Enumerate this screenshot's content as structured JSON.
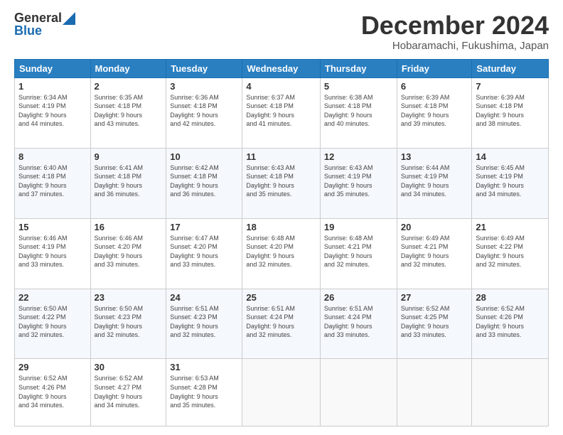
{
  "header": {
    "logo_general": "General",
    "logo_blue": "Blue",
    "month_title": "December 2024",
    "location": "Hobaramachi, Fukushima, Japan"
  },
  "days_of_week": [
    "Sunday",
    "Monday",
    "Tuesday",
    "Wednesday",
    "Thursday",
    "Friday",
    "Saturday"
  ],
  "weeks": [
    [
      {
        "day": "1",
        "info": "Sunrise: 6:34 AM\nSunset: 4:19 PM\nDaylight: 9 hours\nand 44 minutes."
      },
      {
        "day": "2",
        "info": "Sunrise: 6:35 AM\nSunset: 4:18 PM\nDaylight: 9 hours\nand 43 minutes."
      },
      {
        "day": "3",
        "info": "Sunrise: 6:36 AM\nSunset: 4:18 PM\nDaylight: 9 hours\nand 42 minutes."
      },
      {
        "day": "4",
        "info": "Sunrise: 6:37 AM\nSunset: 4:18 PM\nDaylight: 9 hours\nand 41 minutes."
      },
      {
        "day": "5",
        "info": "Sunrise: 6:38 AM\nSunset: 4:18 PM\nDaylight: 9 hours\nand 40 minutes."
      },
      {
        "day": "6",
        "info": "Sunrise: 6:39 AM\nSunset: 4:18 PM\nDaylight: 9 hours\nand 39 minutes."
      },
      {
        "day": "7",
        "info": "Sunrise: 6:39 AM\nSunset: 4:18 PM\nDaylight: 9 hours\nand 38 minutes."
      }
    ],
    [
      {
        "day": "8",
        "info": "Sunrise: 6:40 AM\nSunset: 4:18 PM\nDaylight: 9 hours\nand 37 minutes."
      },
      {
        "day": "9",
        "info": "Sunrise: 6:41 AM\nSunset: 4:18 PM\nDaylight: 9 hours\nand 36 minutes."
      },
      {
        "day": "10",
        "info": "Sunrise: 6:42 AM\nSunset: 4:18 PM\nDaylight: 9 hours\nand 36 minutes."
      },
      {
        "day": "11",
        "info": "Sunrise: 6:43 AM\nSunset: 4:18 PM\nDaylight: 9 hours\nand 35 minutes."
      },
      {
        "day": "12",
        "info": "Sunrise: 6:43 AM\nSunset: 4:19 PM\nDaylight: 9 hours\nand 35 minutes."
      },
      {
        "day": "13",
        "info": "Sunrise: 6:44 AM\nSunset: 4:19 PM\nDaylight: 9 hours\nand 34 minutes."
      },
      {
        "day": "14",
        "info": "Sunrise: 6:45 AM\nSunset: 4:19 PM\nDaylight: 9 hours\nand 34 minutes."
      }
    ],
    [
      {
        "day": "15",
        "info": "Sunrise: 6:46 AM\nSunset: 4:19 PM\nDaylight: 9 hours\nand 33 minutes."
      },
      {
        "day": "16",
        "info": "Sunrise: 6:46 AM\nSunset: 4:20 PM\nDaylight: 9 hours\nand 33 minutes."
      },
      {
        "day": "17",
        "info": "Sunrise: 6:47 AM\nSunset: 4:20 PM\nDaylight: 9 hours\nand 33 minutes."
      },
      {
        "day": "18",
        "info": "Sunrise: 6:48 AM\nSunset: 4:20 PM\nDaylight: 9 hours\nand 32 minutes."
      },
      {
        "day": "19",
        "info": "Sunrise: 6:48 AM\nSunset: 4:21 PM\nDaylight: 9 hours\nand 32 minutes."
      },
      {
        "day": "20",
        "info": "Sunrise: 6:49 AM\nSunset: 4:21 PM\nDaylight: 9 hours\nand 32 minutes."
      },
      {
        "day": "21",
        "info": "Sunrise: 6:49 AM\nSunset: 4:22 PM\nDaylight: 9 hours\nand 32 minutes."
      }
    ],
    [
      {
        "day": "22",
        "info": "Sunrise: 6:50 AM\nSunset: 4:22 PM\nDaylight: 9 hours\nand 32 minutes."
      },
      {
        "day": "23",
        "info": "Sunrise: 6:50 AM\nSunset: 4:23 PM\nDaylight: 9 hours\nand 32 minutes."
      },
      {
        "day": "24",
        "info": "Sunrise: 6:51 AM\nSunset: 4:23 PM\nDaylight: 9 hours\nand 32 minutes."
      },
      {
        "day": "25",
        "info": "Sunrise: 6:51 AM\nSunset: 4:24 PM\nDaylight: 9 hours\nand 32 minutes."
      },
      {
        "day": "26",
        "info": "Sunrise: 6:51 AM\nSunset: 4:24 PM\nDaylight: 9 hours\nand 33 minutes."
      },
      {
        "day": "27",
        "info": "Sunrise: 6:52 AM\nSunset: 4:25 PM\nDaylight: 9 hours\nand 33 minutes."
      },
      {
        "day": "28",
        "info": "Sunrise: 6:52 AM\nSunset: 4:26 PM\nDaylight: 9 hours\nand 33 minutes."
      }
    ],
    [
      {
        "day": "29",
        "info": "Sunrise: 6:52 AM\nSunset: 4:26 PM\nDaylight: 9 hours\nand 34 minutes."
      },
      {
        "day": "30",
        "info": "Sunrise: 6:52 AM\nSunset: 4:27 PM\nDaylight: 9 hours\nand 34 minutes."
      },
      {
        "day": "31",
        "info": "Sunrise: 6:53 AM\nSunset: 4:28 PM\nDaylight: 9 hours\nand 35 minutes."
      },
      {
        "day": "",
        "info": ""
      },
      {
        "day": "",
        "info": ""
      },
      {
        "day": "",
        "info": ""
      },
      {
        "day": "",
        "info": ""
      }
    ]
  ]
}
